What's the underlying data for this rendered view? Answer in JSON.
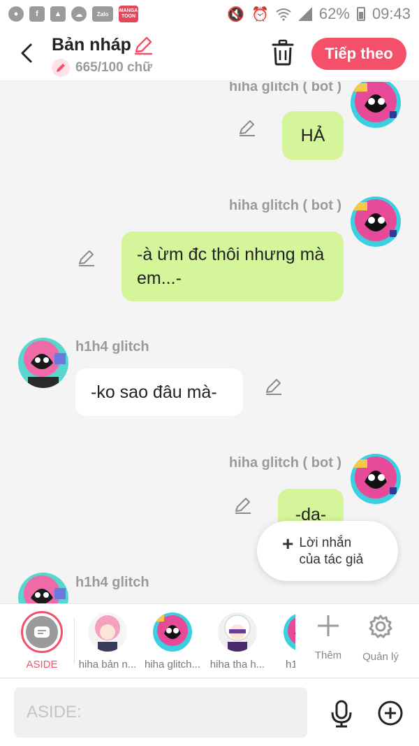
{
  "status_bar": {
    "left_icons": [
      "chat-bubble-icon",
      "facebook-icon",
      "gallery-icon",
      "cloud-icon",
      "zalo-icon",
      "mangatoon-icon"
    ],
    "zalo_label": "Zalo",
    "manga_label": "MANGA TOON",
    "battery": "62%",
    "time": "09:43"
  },
  "header": {
    "title": "Bản nháp",
    "word_count": "665/100 chữ",
    "next_button": "Tiếp theo"
  },
  "messages": [
    {
      "sender": "hiha glitch ( bot )",
      "text": "HẢ",
      "side": "out"
    },
    {
      "sender": "hiha glitch ( bot )",
      "text": "-à ừm đc thôi nhưng mà em...-",
      "side": "out"
    },
    {
      "sender": "h1h4 glitch",
      "text": "-ko sao đâu mà-",
      "side": "in"
    },
    {
      "sender": "hiha glitch ( bot )",
      "text": "-da-",
      "side": "out"
    },
    {
      "sender": "h1h4 glitch",
      "text": "",
      "side": "in"
    }
  ],
  "author_note": {
    "label": "Lời nhắn\ncủa tác giả"
  },
  "character_strip": {
    "aside_label": "ASIDE",
    "characters": [
      "hiha bản n...",
      "hiha glitch...",
      "hiha tha h...",
      "h1"
    ],
    "add_label": "Thêm",
    "manage_label": "Quản lý"
  },
  "input": {
    "placeholder": "ASIDE:"
  },
  "colors": {
    "accent": "#f4506a",
    "bubble_out": "#d4f59a",
    "bubble_in": "#ffffff",
    "background": "#f4f4f4"
  }
}
